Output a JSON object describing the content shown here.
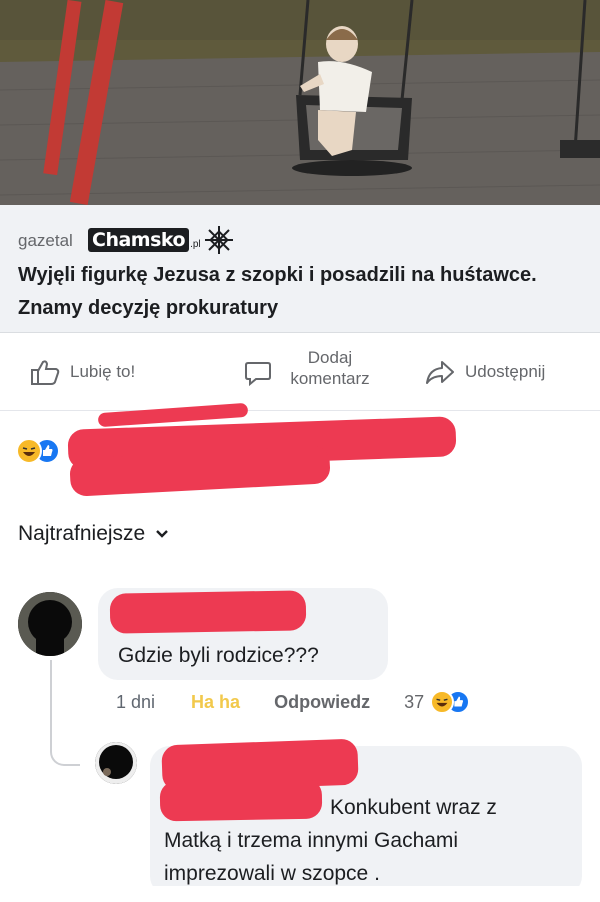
{
  "post": {
    "link_domain": "gazetal",
    "link_title": "Wyjęli figurkę Jezusa z szopki i posadzili na huśtawce. Znamy decyzję prokuratury",
    "watermark": {
      "brand": "Chamsko",
      "suffix": ".pl"
    }
  },
  "actions": {
    "like_label": "Lubię to!",
    "comment_label_line1": "Dodaj",
    "comment_label_line2": "komentarz",
    "share_label": "Udostępnij"
  },
  "reactions": {
    "icons": [
      "haha-icon",
      "like-icon"
    ]
  },
  "comments_sort": {
    "label": "Najtrafniejsze"
  },
  "comments": [
    {
      "text": "Gdzie byli rodzice???",
      "age": "1 dni",
      "reaction_link": "Ha ha",
      "reply_label": "Odpowiedz",
      "reaction_count": "37"
    }
  ],
  "replies": [
    {
      "text_line1": "Konkubent wraz z",
      "text_line2": "Matką i trzema innymi Gachami",
      "text_line3": "imprezowali w  szopce ."
    }
  ],
  "colors": {
    "redaction": "#ed3a52",
    "haha_yellow": "#f7b928",
    "like_blue": "#1877f2",
    "bubble_gray": "#f0f2f5"
  }
}
